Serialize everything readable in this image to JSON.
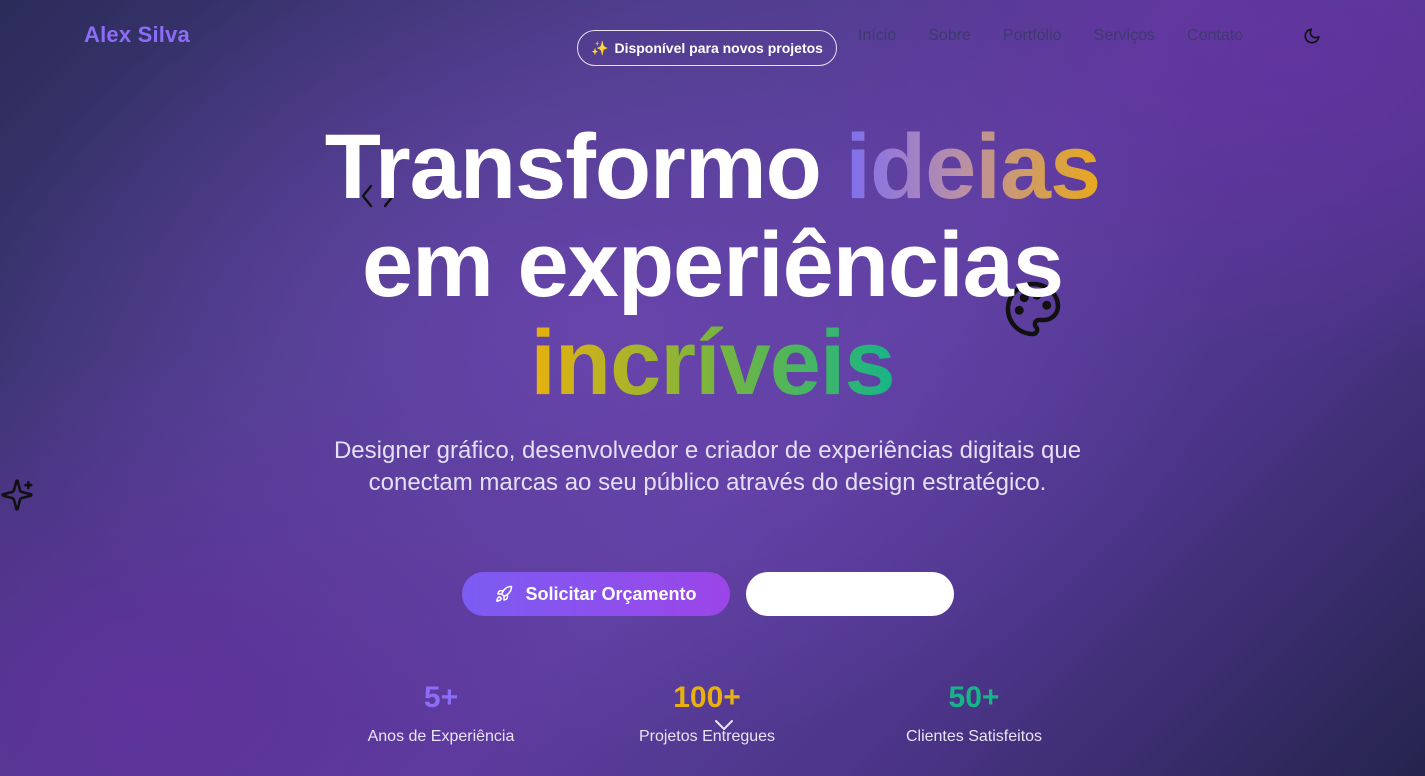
{
  "header": {
    "logo": "Alex Silva",
    "badge": {
      "icon": "sparkles-icon",
      "text": "Disponível para novos projetos"
    },
    "nav": [
      "Início",
      "Sobre",
      "Portfólio",
      "Serviços",
      "Contato"
    ],
    "theme_toggle_icon": "moon-icon"
  },
  "hero": {
    "title_line1_white": "Transformo",
    "title_line1_gradient": "ideias",
    "title_line2": "em experiências",
    "title_line3_gradient": "incríveis",
    "subtitle": "Designer gráfico, desenvolvedor e criador de experiências digitais que conectam marcas ao seu público através do design estratégico.",
    "primary_button": {
      "icon": "rocket-icon",
      "label": "Solicitar Orçamento"
    },
    "secondary_button": {
      "label": ""
    }
  },
  "stats": [
    {
      "value": "5+",
      "label": "Anos de Experiência",
      "color": "#8b6ef5"
    },
    {
      "value": "100+",
      "label": "Projetos Entregues",
      "color": "#e8b10f"
    },
    {
      "value": "50+",
      "label": "Clientes Satisfeitos",
      "color": "#16b587"
    }
  ],
  "decorations": [
    "code-icon",
    "palette-icon",
    "sparkle-star-icon",
    "chevron-down-icon"
  ],
  "colors": {
    "accent": "#8b6ef5",
    "gold": "#e8b10f",
    "green": "#16b587",
    "nav_text": "#3d3a6e"
  }
}
